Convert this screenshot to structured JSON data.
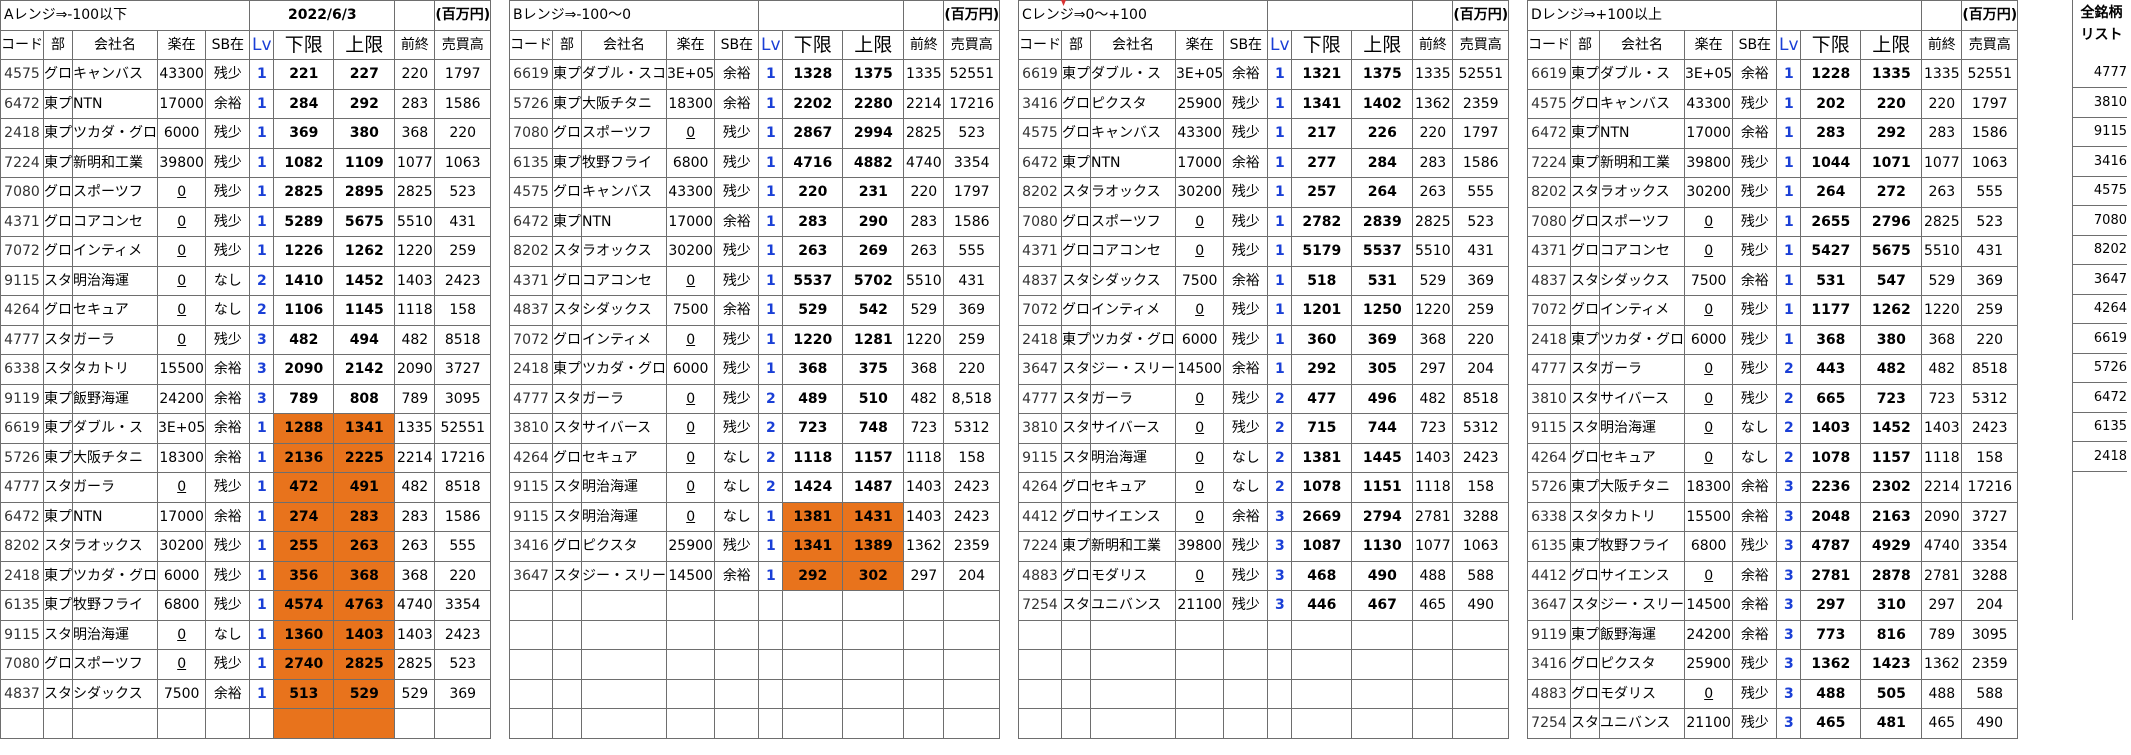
{
  "date": "2022/6/3",
  "unit": "(百万円)",
  "headers": {
    "code": "コード",
    "bu": "部",
    "name": "会社名",
    "rakuzai": "楽在",
    "sb": "SB在",
    "lv": "Lv",
    "lower": "下限",
    "upper": "上限",
    "prev": "前終",
    "sales": "売買高"
  },
  "list_title": [
    "全銘柄",
    "リスト"
  ],
  "list_items": [
    "4777",
    "3810",
    "9115",
    "3416",
    "4575",
    "7080",
    "8202",
    "3647",
    "4264",
    "6619",
    "5726",
    "6472",
    "6135",
    "2418"
  ],
  "blocks": [
    {
      "title": "Aレンジ⇒-100以下",
      "rows": [
        [
          "4575",
          "グロ",
          "キャンバス",
          "43300",
          "残少",
          "1",
          "221",
          "227",
          "220",
          "1797"
        ],
        [
          "6472",
          "東プ",
          "NTN",
          "17000",
          "余裕",
          "1",
          "284",
          "292",
          "283",
          "1586"
        ],
        [
          "2418",
          "東プ",
          "ツカダ・グロ",
          "6000",
          "残少",
          "1",
          "369",
          "380",
          "368",
          "220"
        ],
        [
          "7224",
          "東プ",
          "新明和工業",
          "39800",
          "残少",
          "1",
          "1082",
          "1109",
          "1077",
          "1063"
        ],
        [
          "7080",
          "グロ",
          "スポーツフ",
          "0",
          "残少",
          "1",
          "2825",
          "2895",
          "2825",
          "523"
        ],
        [
          "4371",
          "グロ",
          "コアコンセ",
          "0",
          "残少",
          "1",
          "5289",
          "5675",
          "5510",
          "431"
        ],
        [
          "7072",
          "グロ",
          "インティメ",
          "0",
          "残少",
          "1",
          "1226",
          "1262",
          "1220",
          "259"
        ],
        [
          "9115",
          "スタ",
          "明治海運",
          "0",
          "なし",
          "2",
          "1410",
          "1452",
          "1403",
          "2423"
        ],
        [
          "4264",
          "グロ",
          "セキュア",
          "0",
          "なし",
          "2",
          "1106",
          "1145",
          "1118",
          "158"
        ],
        [
          "4777",
          "スタ",
          "ガーラ",
          "0",
          "残少",
          "3",
          "482",
          "494",
          "482",
          "8518"
        ],
        [
          "6338",
          "スタ",
          "タカトリ",
          "15500",
          "余裕",
          "3",
          "2090",
          "2142",
          "2090",
          "3727"
        ],
        [
          "9119",
          "東プ",
          "飯野海運",
          "24200",
          "余裕",
          "3",
          "789",
          "808",
          "789",
          "3095"
        ],
        [
          "6619",
          "東プ",
          "ダブル・ス",
          "3E+05",
          "余裕",
          "1",
          "1288",
          "1341",
          "1335",
          "52551"
        ],
        [
          "5726",
          "東プ",
          "大阪チタニ",
          "18300",
          "余裕",
          "1",
          "2136",
          "2225",
          "2214",
          "17216"
        ],
        [
          "4777",
          "スタ",
          "ガーラ",
          "0",
          "残少",
          "1",
          "472",
          "491",
          "482",
          "8518"
        ],
        [
          "6472",
          "東プ",
          "NTN",
          "17000",
          "余裕",
          "1",
          "274",
          "283",
          "283",
          "1586"
        ],
        [
          "8202",
          "スタ",
          "ラオックス",
          "30200",
          "残少",
          "1",
          "255",
          "263",
          "263",
          "555"
        ],
        [
          "2418",
          "東プ",
          "ツカダ・グロ",
          "6000",
          "残少",
          "1",
          "356",
          "368",
          "368",
          "220"
        ],
        [
          "6135",
          "東プ",
          "牧野フライ",
          "6800",
          "残少",
          "1",
          "4574",
          "4763",
          "4740",
          "3354"
        ],
        [
          "9115",
          "スタ",
          "明治海運",
          "0",
          "なし",
          "1",
          "1360",
          "1403",
          "1403",
          "2423"
        ],
        [
          "7080",
          "グロ",
          "スポーツフ",
          "0",
          "残少",
          "1",
          "2740",
          "2825",
          "2825",
          "523"
        ],
        [
          "4837",
          "スタ",
          "シダックス",
          "7500",
          "余裕",
          "1",
          "513",
          "529",
          "529",
          "369"
        ],
        [
          "",
          "",
          "",
          "",
          "",
          "",
          "",
          "",
          "",
          ""
        ]
      ]
    },
    {
      "title": "Bレンジ⇒-100〜0",
      "rows": [
        [
          "6619",
          "東プ",
          "ダブル・スコ",
          "3E+05",
          "余裕",
          "1",
          "1328",
          "1375",
          "1335",
          "52551"
        ],
        [
          "5726",
          "東プ",
          "大阪チタニ",
          "18300",
          "余裕",
          "1",
          "2202",
          "2280",
          "2214",
          "17216"
        ],
        [
          "7080",
          "グロ",
          "スポーツフ",
          "0",
          "残少",
          "1",
          "2867",
          "2994",
          "2825",
          "523"
        ],
        [
          "6135",
          "東プ",
          "牧野フライ",
          "6800",
          "残少",
          "1",
          "4716",
          "4882",
          "4740",
          "3354"
        ],
        [
          "4575",
          "グロ",
          "キャンバス",
          "43300",
          "残少",
          "1",
          "220",
          "231",
          "220",
          "1797"
        ],
        [
          "6472",
          "東プ",
          "NTN",
          "17000",
          "余裕",
          "1",
          "283",
          "290",
          "283",
          "1586"
        ],
        [
          "8202",
          "スタ",
          "ラオックス",
          "30200",
          "残少",
          "1",
          "263",
          "269",
          "263",
          "555"
        ],
        [
          "4371",
          "グロ",
          "コアコンセ",
          "0",
          "残少",
          "1",
          "5537",
          "5702",
          "5510",
          "431"
        ],
        [
          "4837",
          "スタ",
          "シダックス",
          "7500",
          "余裕",
          "1",
          "529",
          "542",
          "529",
          "369"
        ],
        [
          "7072",
          "グロ",
          "インティメ",
          "0",
          "残少",
          "1",
          "1220",
          "1281",
          "1220",
          "259"
        ],
        [
          "2418",
          "東プ",
          "ツカダ・グロ",
          "6000",
          "残少",
          "1",
          "368",
          "375",
          "368",
          "220"
        ],
        [
          "4777",
          "スタ",
          "ガーラ",
          "0",
          "残少",
          "2",
          "489",
          "510",
          "482",
          "8,518"
        ],
        [
          "3810",
          "スタ",
          "サイバース",
          "0",
          "残少",
          "2",
          "723",
          "748",
          "723",
          "5312"
        ],
        [
          "4264",
          "グロ",
          "セキュア",
          "0",
          "なし",
          "2",
          "1118",
          "1157",
          "1118",
          "158"
        ],
        [
          "9115",
          "スタ",
          "明治海運",
          "0",
          "なし",
          "2",
          "1424",
          "1487",
          "1403",
          "2423"
        ],
        [
          "9115",
          "スタ",
          "明治海運",
          "0",
          "なし",
          "1",
          "1381",
          "1431",
          "1403",
          "2423"
        ],
        [
          "3416",
          "グロ",
          "ピクスタ",
          "25900",
          "残少",
          "1",
          "1341",
          "1389",
          "1362",
          "2359"
        ],
        [
          "3647",
          "スタ",
          "ジー・スリー",
          "14500",
          "余裕",
          "1",
          "292",
          "302",
          "297",
          "204"
        ]
      ]
    },
    {
      "title": "Cレンジ⇒0〜+100",
      "rows": [
        [
          "6619",
          "東プ",
          "ダブル・ス",
          "3E+05",
          "余裕",
          "1",
          "1321",
          "1375",
          "1335",
          "52551"
        ],
        [
          "3416",
          "グロ",
          "ピクスタ",
          "25900",
          "残少",
          "1",
          "1341",
          "1402",
          "1362",
          "2359"
        ],
        [
          "4575",
          "グロ",
          "キャンバス",
          "43300",
          "残少",
          "1",
          "217",
          "226",
          "220",
          "1797"
        ],
        [
          "6472",
          "東プ",
          "NTN",
          "17000",
          "余裕",
          "1",
          "277",
          "284",
          "283",
          "1586"
        ],
        [
          "8202",
          "スタ",
          "ラオックス",
          "30200",
          "残少",
          "1",
          "257",
          "264",
          "263",
          "555"
        ],
        [
          "7080",
          "グロ",
          "スポーツフ",
          "0",
          "残少",
          "1",
          "2782",
          "2839",
          "2825",
          "523"
        ],
        [
          "4371",
          "グロ",
          "コアコンセ",
          "0",
          "残少",
          "1",
          "5179",
          "5537",
          "5510",
          "431"
        ],
        [
          "4837",
          "スタ",
          "シダックス",
          "7500",
          "余裕",
          "1",
          "518",
          "531",
          "529",
          "369"
        ],
        [
          "7072",
          "グロ",
          "インティメ",
          "0",
          "残少",
          "1",
          "1201",
          "1250",
          "1220",
          "259"
        ],
        [
          "2418",
          "東プ",
          "ツカダ・グロ",
          "6000",
          "残少",
          "1",
          "360",
          "369",
          "368",
          "220"
        ],
        [
          "3647",
          "スタ",
          "ジー・スリー",
          "14500",
          "余裕",
          "1",
          "292",
          "305",
          "297",
          "204"
        ],
        [
          "4777",
          "スタ",
          "ガーラ",
          "0",
          "残少",
          "2",
          "477",
          "496",
          "482",
          "8518"
        ],
        [
          "3810",
          "スタ",
          "サイバース",
          "0",
          "残少",
          "2",
          "715",
          "744",
          "723",
          "5312"
        ],
        [
          "9115",
          "スタ",
          "明治海運",
          "0",
          "なし",
          "2",
          "1381",
          "1445",
          "1403",
          "2423"
        ],
        [
          "4264",
          "グロ",
          "セキュア",
          "0",
          "なし",
          "2",
          "1078",
          "1151",
          "1118",
          "158"
        ],
        [
          "4412",
          "グロ",
          "サイエンス",
          "0",
          "余裕",
          "3",
          "2669",
          "2794",
          "2781",
          "3288"
        ],
        [
          "7224",
          "東プ",
          "新明和工業",
          "39800",
          "残少",
          "3",
          "1087",
          "1130",
          "1077",
          "1063"
        ],
        [
          "4883",
          "グロ",
          "モダリス",
          "0",
          "残少",
          "3",
          "468",
          "490",
          "488",
          "588"
        ],
        [
          "7254",
          "スタ",
          "ユニバンス",
          "21100",
          "残少",
          "3",
          "446",
          "467",
          "465",
          "490"
        ]
      ]
    },
    {
      "title": "Dレンジ⇒+100以上",
      "rows": [
        [
          "6619",
          "東プ",
          "ダブル・ス",
          "3E+05",
          "余裕",
          "1",
          "1228",
          "1335",
          "1335",
          "52551"
        ],
        [
          "4575",
          "グロ",
          "キャンバス",
          "43300",
          "残少",
          "1",
          "202",
          "220",
          "220",
          "1797"
        ],
        [
          "6472",
          "東プ",
          "NTN",
          "17000",
          "余裕",
          "1",
          "283",
          "292",
          "283",
          "1586"
        ],
        [
          "7224",
          "東プ",
          "新明和工業",
          "39800",
          "残少",
          "1",
          "1044",
          "1071",
          "1077",
          "1063"
        ],
        [
          "8202",
          "スタ",
          "ラオックス",
          "30200",
          "残少",
          "1",
          "264",
          "272",
          "263",
          "555"
        ],
        [
          "7080",
          "グロ",
          "スポーツフ",
          "0",
          "残少",
          "1",
          "2655",
          "2796",
          "2825",
          "523"
        ],
        [
          "4371",
          "グロ",
          "コアコンセ",
          "0",
          "残少",
          "1",
          "5427",
          "5675",
          "5510",
          "431"
        ],
        [
          "4837",
          "スタ",
          "シダックス",
          "7500",
          "余裕",
          "1",
          "531",
          "547",
          "529",
          "369"
        ],
        [
          "7072",
          "グロ",
          "インティメ",
          "0",
          "残少",
          "1",
          "1177",
          "1262",
          "1220",
          "259"
        ],
        [
          "2418",
          "東プ",
          "ツカダ・グロ",
          "6000",
          "残少",
          "1",
          "368",
          "380",
          "368",
          "220"
        ],
        [
          "4777",
          "スタ",
          "ガーラ",
          "0",
          "残少",
          "2",
          "443",
          "482",
          "482",
          "8518"
        ],
        [
          "3810",
          "スタ",
          "サイバース",
          "0",
          "残少",
          "2",
          "665",
          "723",
          "723",
          "5312"
        ],
        [
          "9115",
          "スタ",
          "明治海運",
          "0",
          "なし",
          "2",
          "1403",
          "1452",
          "1403",
          "2423"
        ],
        [
          "4264",
          "グロ",
          "セキュア",
          "0",
          "なし",
          "2",
          "1078",
          "1157",
          "1118",
          "158"
        ],
        [
          "5726",
          "東プ",
          "大阪チタニ",
          "18300",
          "余裕",
          "3",
          "2236",
          "2302",
          "2214",
          "17216"
        ],
        [
          "6338",
          "スタ",
          "タカトリ",
          "15500",
          "余裕",
          "3",
          "2048",
          "2163",
          "2090",
          "3727"
        ],
        [
          "6135",
          "東プ",
          "牧野フライ",
          "6800",
          "残少",
          "3",
          "4787",
          "4929",
          "4740",
          "3354"
        ],
        [
          "4412",
          "グロ",
          "サイエンス",
          "0",
          "余裕",
          "3",
          "2781",
          "2878",
          "2781",
          "3288"
        ],
        [
          "3647",
          "スタ",
          "ジー・スリー",
          "14500",
          "余裕",
          "3",
          "297",
          "310",
          "297",
          "204"
        ],
        [
          "9119",
          "東プ",
          "飯野海運",
          "24200",
          "余裕",
          "3",
          "773",
          "816",
          "789",
          "3095"
        ],
        [
          "3416",
          "グロ",
          "ピクスタ",
          "25900",
          "残少",
          "3",
          "1362",
          "1423",
          "1362",
          "2359"
        ],
        [
          "4883",
          "グロ",
          "モダリス",
          "0",
          "残少",
          "3",
          "488",
          "505",
          "488",
          "588"
        ],
        [
          "7254",
          "スタ",
          "ユニバンス",
          "21100",
          "残少",
          "3",
          "465",
          "481",
          "465",
          "490"
        ]
      ]
    }
  ],
  "highlight": {
    "block_a_rows": [
      12,
      22
    ],
    "block_b_rows": [
      15,
      17
    ]
  },
  "colors": {
    "highlight": "#e8731c",
    "level": "#1a3fd6",
    "grid": "#6e6e6e"
  }
}
